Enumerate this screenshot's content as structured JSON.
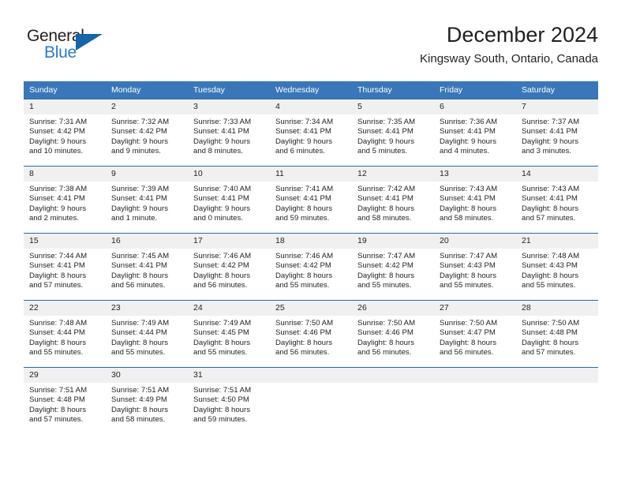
{
  "brand": {
    "name_top": "General",
    "name_bottom": "Blue",
    "accent_color": "#2b7cc4",
    "triangle_color": "#1565a8"
  },
  "header": {
    "title": "December 2024",
    "subtitle": "Kingsway South, Ontario, Canada"
  },
  "theme": {
    "header_bg": "#3a77b8",
    "header_text": "#ffffff",
    "daynum_bg": "#f0f0f0",
    "row_border": "#2a6aa8",
    "body_text": "#231f20"
  },
  "weekdays": [
    "Sunday",
    "Monday",
    "Tuesday",
    "Wednesday",
    "Thursday",
    "Friday",
    "Saturday"
  ],
  "weeks": [
    [
      {
        "day": "1",
        "sunrise": "Sunrise: 7:31 AM",
        "sunset": "Sunset: 4:42 PM",
        "daylight_1": "Daylight: 9 hours",
        "daylight_2": "and 10 minutes."
      },
      {
        "day": "2",
        "sunrise": "Sunrise: 7:32 AM",
        "sunset": "Sunset: 4:42 PM",
        "daylight_1": "Daylight: 9 hours",
        "daylight_2": "and 9 minutes."
      },
      {
        "day": "3",
        "sunrise": "Sunrise: 7:33 AM",
        "sunset": "Sunset: 4:41 PM",
        "daylight_1": "Daylight: 9 hours",
        "daylight_2": "and 8 minutes."
      },
      {
        "day": "4",
        "sunrise": "Sunrise: 7:34 AM",
        "sunset": "Sunset: 4:41 PM",
        "daylight_1": "Daylight: 9 hours",
        "daylight_2": "and 6 minutes."
      },
      {
        "day": "5",
        "sunrise": "Sunrise: 7:35 AM",
        "sunset": "Sunset: 4:41 PM",
        "daylight_1": "Daylight: 9 hours",
        "daylight_2": "and 5 minutes."
      },
      {
        "day": "6",
        "sunrise": "Sunrise: 7:36 AM",
        "sunset": "Sunset: 4:41 PM",
        "daylight_1": "Daylight: 9 hours",
        "daylight_2": "and 4 minutes."
      },
      {
        "day": "7",
        "sunrise": "Sunrise: 7:37 AM",
        "sunset": "Sunset: 4:41 PM",
        "daylight_1": "Daylight: 9 hours",
        "daylight_2": "and 3 minutes."
      }
    ],
    [
      {
        "day": "8",
        "sunrise": "Sunrise: 7:38 AM",
        "sunset": "Sunset: 4:41 PM",
        "daylight_1": "Daylight: 9 hours",
        "daylight_2": "and 2 minutes."
      },
      {
        "day": "9",
        "sunrise": "Sunrise: 7:39 AM",
        "sunset": "Sunset: 4:41 PM",
        "daylight_1": "Daylight: 9 hours",
        "daylight_2": "and 1 minute."
      },
      {
        "day": "10",
        "sunrise": "Sunrise: 7:40 AM",
        "sunset": "Sunset: 4:41 PM",
        "daylight_1": "Daylight: 9 hours",
        "daylight_2": "and 0 minutes."
      },
      {
        "day": "11",
        "sunrise": "Sunrise: 7:41 AM",
        "sunset": "Sunset: 4:41 PM",
        "daylight_1": "Daylight: 8 hours",
        "daylight_2": "and 59 minutes."
      },
      {
        "day": "12",
        "sunrise": "Sunrise: 7:42 AM",
        "sunset": "Sunset: 4:41 PM",
        "daylight_1": "Daylight: 8 hours",
        "daylight_2": "and 58 minutes."
      },
      {
        "day": "13",
        "sunrise": "Sunrise: 7:43 AM",
        "sunset": "Sunset: 4:41 PM",
        "daylight_1": "Daylight: 8 hours",
        "daylight_2": "and 58 minutes."
      },
      {
        "day": "14",
        "sunrise": "Sunrise: 7:43 AM",
        "sunset": "Sunset: 4:41 PM",
        "daylight_1": "Daylight: 8 hours",
        "daylight_2": "and 57 minutes."
      }
    ],
    [
      {
        "day": "15",
        "sunrise": "Sunrise: 7:44 AM",
        "sunset": "Sunset: 4:41 PM",
        "daylight_1": "Daylight: 8 hours",
        "daylight_2": "and 57 minutes."
      },
      {
        "day": "16",
        "sunrise": "Sunrise: 7:45 AM",
        "sunset": "Sunset: 4:41 PM",
        "daylight_1": "Daylight: 8 hours",
        "daylight_2": "and 56 minutes."
      },
      {
        "day": "17",
        "sunrise": "Sunrise: 7:46 AM",
        "sunset": "Sunset: 4:42 PM",
        "daylight_1": "Daylight: 8 hours",
        "daylight_2": "and 56 minutes."
      },
      {
        "day": "18",
        "sunrise": "Sunrise: 7:46 AM",
        "sunset": "Sunset: 4:42 PM",
        "daylight_1": "Daylight: 8 hours",
        "daylight_2": "and 55 minutes."
      },
      {
        "day": "19",
        "sunrise": "Sunrise: 7:47 AM",
        "sunset": "Sunset: 4:42 PM",
        "daylight_1": "Daylight: 8 hours",
        "daylight_2": "and 55 minutes."
      },
      {
        "day": "20",
        "sunrise": "Sunrise: 7:47 AM",
        "sunset": "Sunset: 4:43 PM",
        "daylight_1": "Daylight: 8 hours",
        "daylight_2": "and 55 minutes."
      },
      {
        "day": "21",
        "sunrise": "Sunrise: 7:48 AM",
        "sunset": "Sunset: 4:43 PM",
        "daylight_1": "Daylight: 8 hours",
        "daylight_2": "and 55 minutes."
      }
    ],
    [
      {
        "day": "22",
        "sunrise": "Sunrise: 7:48 AM",
        "sunset": "Sunset: 4:44 PM",
        "daylight_1": "Daylight: 8 hours",
        "daylight_2": "and 55 minutes."
      },
      {
        "day": "23",
        "sunrise": "Sunrise: 7:49 AM",
        "sunset": "Sunset: 4:44 PM",
        "daylight_1": "Daylight: 8 hours",
        "daylight_2": "and 55 minutes."
      },
      {
        "day": "24",
        "sunrise": "Sunrise: 7:49 AM",
        "sunset": "Sunset: 4:45 PM",
        "daylight_1": "Daylight: 8 hours",
        "daylight_2": "and 55 minutes."
      },
      {
        "day": "25",
        "sunrise": "Sunrise: 7:50 AM",
        "sunset": "Sunset: 4:46 PM",
        "daylight_1": "Daylight: 8 hours",
        "daylight_2": "and 56 minutes."
      },
      {
        "day": "26",
        "sunrise": "Sunrise: 7:50 AM",
        "sunset": "Sunset: 4:46 PM",
        "daylight_1": "Daylight: 8 hours",
        "daylight_2": "and 56 minutes."
      },
      {
        "day": "27",
        "sunrise": "Sunrise: 7:50 AM",
        "sunset": "Sunset: 4:47 PM",
        "daylight_1": "Daylight: 8 hours",
        "daylight_2": "and 56 minutes."
      },
      {
        "day": "28",
        "sunrise": "Sunrise: 7:50 AM",
        "sunset": "Sunset: 4:48 PM",
        "daylight_1": "Daylight: 8 hours",
        "daylight_2": "and 57 minutes."
      }
    ],
    [
      {
        "day": "29",
        "sunrise": "Sunrise: 7:51 AM",
        "sunset": "Sunset: 4:48 PM",
        "daylight_1": "Daylight: 8 hours",
        "daylight_2": "and 57 minutes."
      },
      {
        "day": "30",
        "sunrise": "Sunrise: 7:51 AM",
        "sunset": "Sunset: 4:49 PM",
        "daylight_1": "Daylight: 8 hours",
        "daylight_2": "and 58 minutes."
      },
      {
        "day": "31",
        "sunrise": "Sunrise: 7:51 AM",
        "sunset": "Sunset: 4:50 PM",
        "daylight_1": "Daylight: 8 hours",
        "daylight_2": "and 59 minutes."
      },
      {
        "day": "",
        "sunrise": "",
        "sunset": "",
        "daylight_1": "",
        "daylight_2": ""
      },
      {
        "day": "",
        "sunrise": "",
        "sunset": "",
        "daylight_1": "",
        "daylight_2": ""
      },
      {
        "day": "",
        "sunrise": "",
        "sunset": "",
        "daylight_1": "",
        "daylight_2": ""
      },
      {
        "day": "",
        "sunrise": "",
        "sunset": "",
        "daylight_1": "",
        "daylight_2": ""
      }
    ]
  ]
}
